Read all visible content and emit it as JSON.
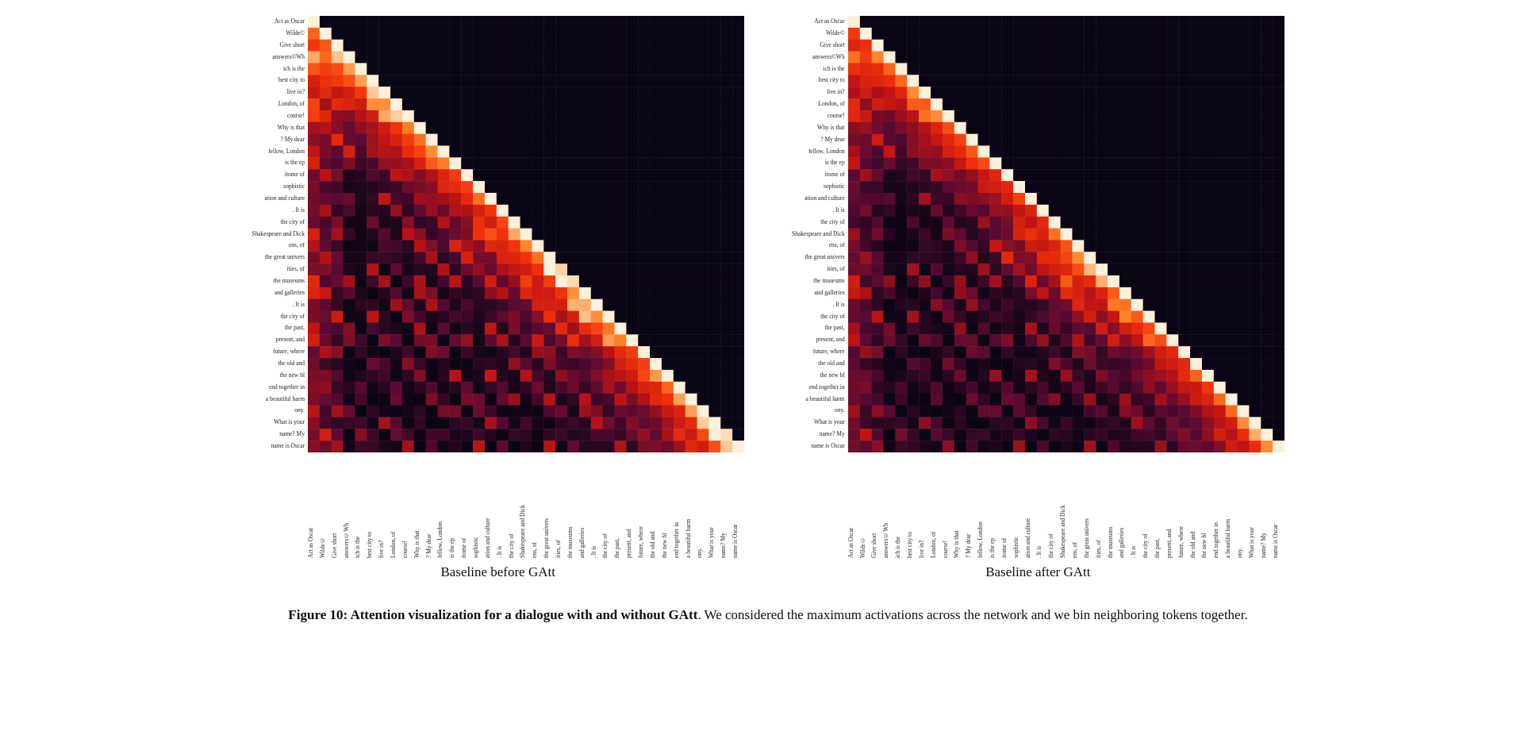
{
  "charts": [
    {
      "id": "before",
      "title": "Baseline before GAtt"
    },
    {
      "id": "after",
      "title": "Baseline after GAtt"
    }
  ],
  "tokens": [
    "Act as Oscar",
    "Wilde©",
    "Give short",
    "answers©Wh",
    "ich is the",
    "best city to",
    "live in?",
    "London, of",
    "course!",
    "Why is that",
    "? My dear",
    "fellow, London",
    "is the ep",
    "itome of",
    "sophistic",
    "ation and culture",
    ". It is",
    "the city of",
    "Shakespeare and Dick",
    "ens, of",
    "the great univers",
    "ities, of",
    "the museums",
    "and galleries",
    ". It is",
    "the city of",
    "the past,",
    "present, and",
    "future, where",
    "the old and",
    "the new bl",
    "end together in",
    "a beautiful harm",
    "ony.",
    "What is your",
    "name? My",
    "name is Oscar"
  ],
  "caption": {
    "label": "Figure 10:",
    "bold_part": "Attention visualization for a dialogue with and without GAtt",
    "rest": ". We considered the maximum activations across the network and we bin neighboring tokens together."
  }
}
